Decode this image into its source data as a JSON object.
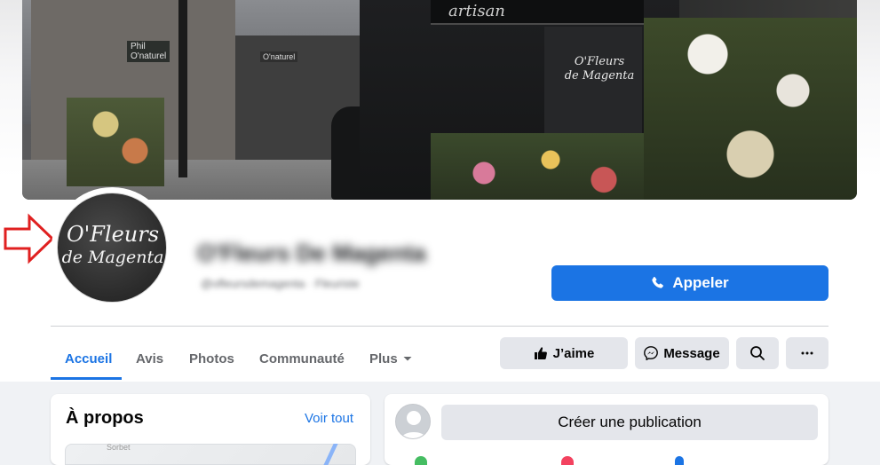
{
  "cover": {
    "shop_sign_text": "artisan",
    "panel_text_line1": "O'Fleurs",
    "panel_text_line2": "de Magenta",
    "street_sign_line1": "Phil",
    "street_sign_line2": "O'naturel",
    "street_sign2": "O'naturel"
  },
  "profile": {
    "logo_line1": "O'Fleurs",
    "logo_line2": "de Magenta",
    "name": "O'Fleurs De Magenta",
    "handle": "@ofleursdemagenta · Fleuriste"
  },
  "actions": {
    "call_label": "Appeler",
    "like_label": "J’aime",
    "message_label": "Message"
  },
  "tabs": [
    {
      "label": "Accueil",
      "active": true
    },
    {
      "label": "Avis",
      "active": false
    },
    {
      "label": "Photos",
      "active": false
    },
    {
      "label": "Communauté",
      "active": false
    },
    {
      "label": "Plus",
      "active": false
    }
  ],
  "about": {
    "title": "À propos",
    "see_all": "Voir tout",
    "map_street": "Sorbet"
  },
  "composer": {
    "create_post_label": "Créer une publication"
  },
  "colors": {
    "accent": "#1b74e4",
    "annotation_arrow": "#e02020"
  },
  "icons": {
    "call": "phone-icon",
    "like": "thumbs-up-icon",
    "message": "messenger-icon",
    "search": "search-icon",
    "more": "more-horizontal-icon",
    "dropdown": "caret-down-icon"
  }
}
